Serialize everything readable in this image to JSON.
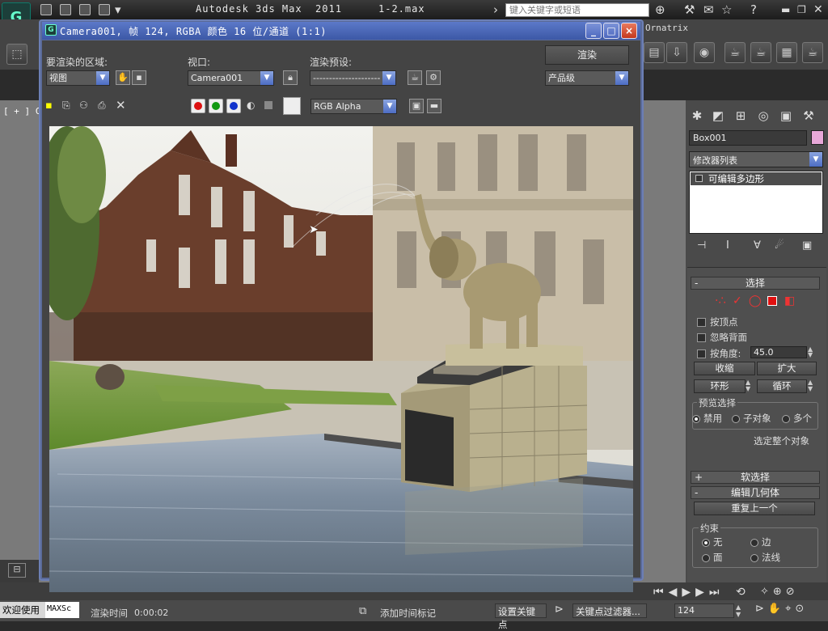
{
  "app": {
    "title": "Autodesk 3ds Max  2011",
    "file": "1-2.max",
    "search_placeholder": "键入关键字或短语",
    "top_right_label": "Ornatrix"
  },
  "viewport": {
    "label": "[ + ] C"
  },
  "render_dialog": {
    "title": "Camera001, 帧 124, RGBA 颜色 16 位/通道 (1:1)",
    "area_label": "要渲染的区域:",
    "area_value": "视图",
    "viewport_label": "视口:",
    "viewport_value": "Camera001",
    "preset_label": "渲染预设:",
    "preset_value": "---------------------",
    "render_button": "渲染",
    "quality_value": "产品级",
    "channel_value": "RGB Alpha",
    "window_buttons": [
      "_",
      "□",
      "×"
    ],
    "channel_colors": {
      "red": "#dd1111",
      "green": "#119911",
      "blue": "#1133cc"
    }
  },
  "command_panel": {
    "object_name": "Box001",
    "object_color": "#e8a8d8",
    "modifier_list": "修改器列表",
    "stack_item": "可编辑多边形",
    "selection": {
      "header": "选择",
      "by_vertex": "按顶点",
      "ignore_backfacing": "忽略背面",
      "by_angle": "按角度:",
      "angle_value": "45.0",
      "shrink": "收缩",
      "grow": "扩大",
      "ring": "环形",
      "loop": "循环",
      "preview_label": "预览选择",
      "preview_options": [
        "禁用",
        "子对象",
        "多个"
      ],
      "select_whole": "选定整个对象"
    },
    "soft_selection": "软选择",
    "edit_geometry": "编辑几何体",
    "repeat_last": "重复上一个",
    "constraints": {
      "label": "约束",
      "options": [
        "无",
        "边",
        "面",
        "法线"
      ]
    }
  },
  "status": {
    "welcome": "欢迎使用",
    "maxscript": "MAXSc",
    "render_time_label": "渲染时间",
    "render_time_value": "0:00:02",
    "add_time_tag": "添加时间标记",
    "set_key": "设置关键点",
    "key_filters": "关键点过滤器...",
    "frame": "124"
  }
}
